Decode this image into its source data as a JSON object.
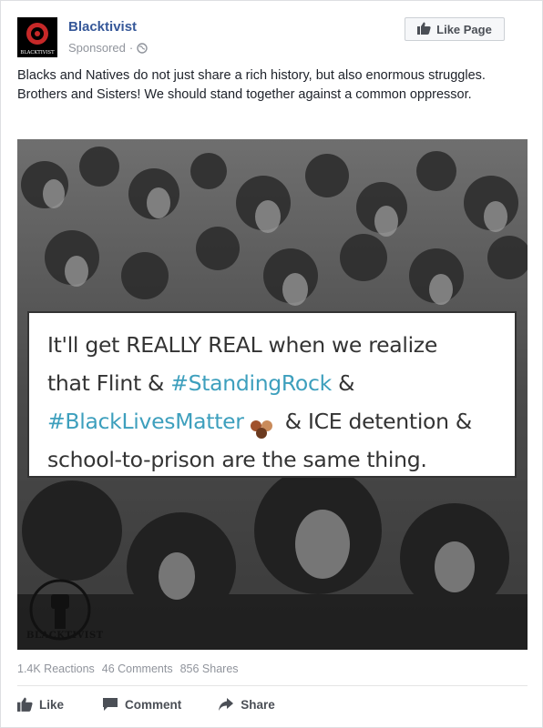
{
  "post": {
    "page_name": "Blacktivist",
    "sponsored_label": "Sponsored",
    "separator": "·",
    "like_page_label": "Like Page",
    "text": "Blacks and Natives do not just share a rich history, but also enormous struggles. Brothers and Sisters! We should stand together against a common oppressor.",
    "avatar_text": "BLACKTIVIST",
    "icons": [
      "globe-icon",
      "thumbs-up-icon",
      "comment-icon",
      "share-arrow-icon"
    ]
  },
  "image": {
    "line1": "It'll get REALLY REAL when we realize",
    "line2_a": "that Flint & ",
    "line2_tag": "#StandingRock",
    "line2_b": " &",
    "line3_tag": "#BlackLivesMatter",
    "line3_b": " & ICE detention &",
    "line4": "school-to-prison are the same thing.",
    "watermark": "BLACKTIVIST",
    "hashtag_color": "#3d9fbd"
  },
  "stats": {
    "reactions": "1.4K Reactions",
    "comments": "46 Comments",
    "shares": "856 Shares"
  },
  "actions": {
    "like": "Like",
    "comment": "Comment",
    "share": "Share"
  },
  "colors": {
    "link_blue": "#365899",
    "meta_gray": "#90949c",
    "action_gray": "#4b4f56"
  }
}
